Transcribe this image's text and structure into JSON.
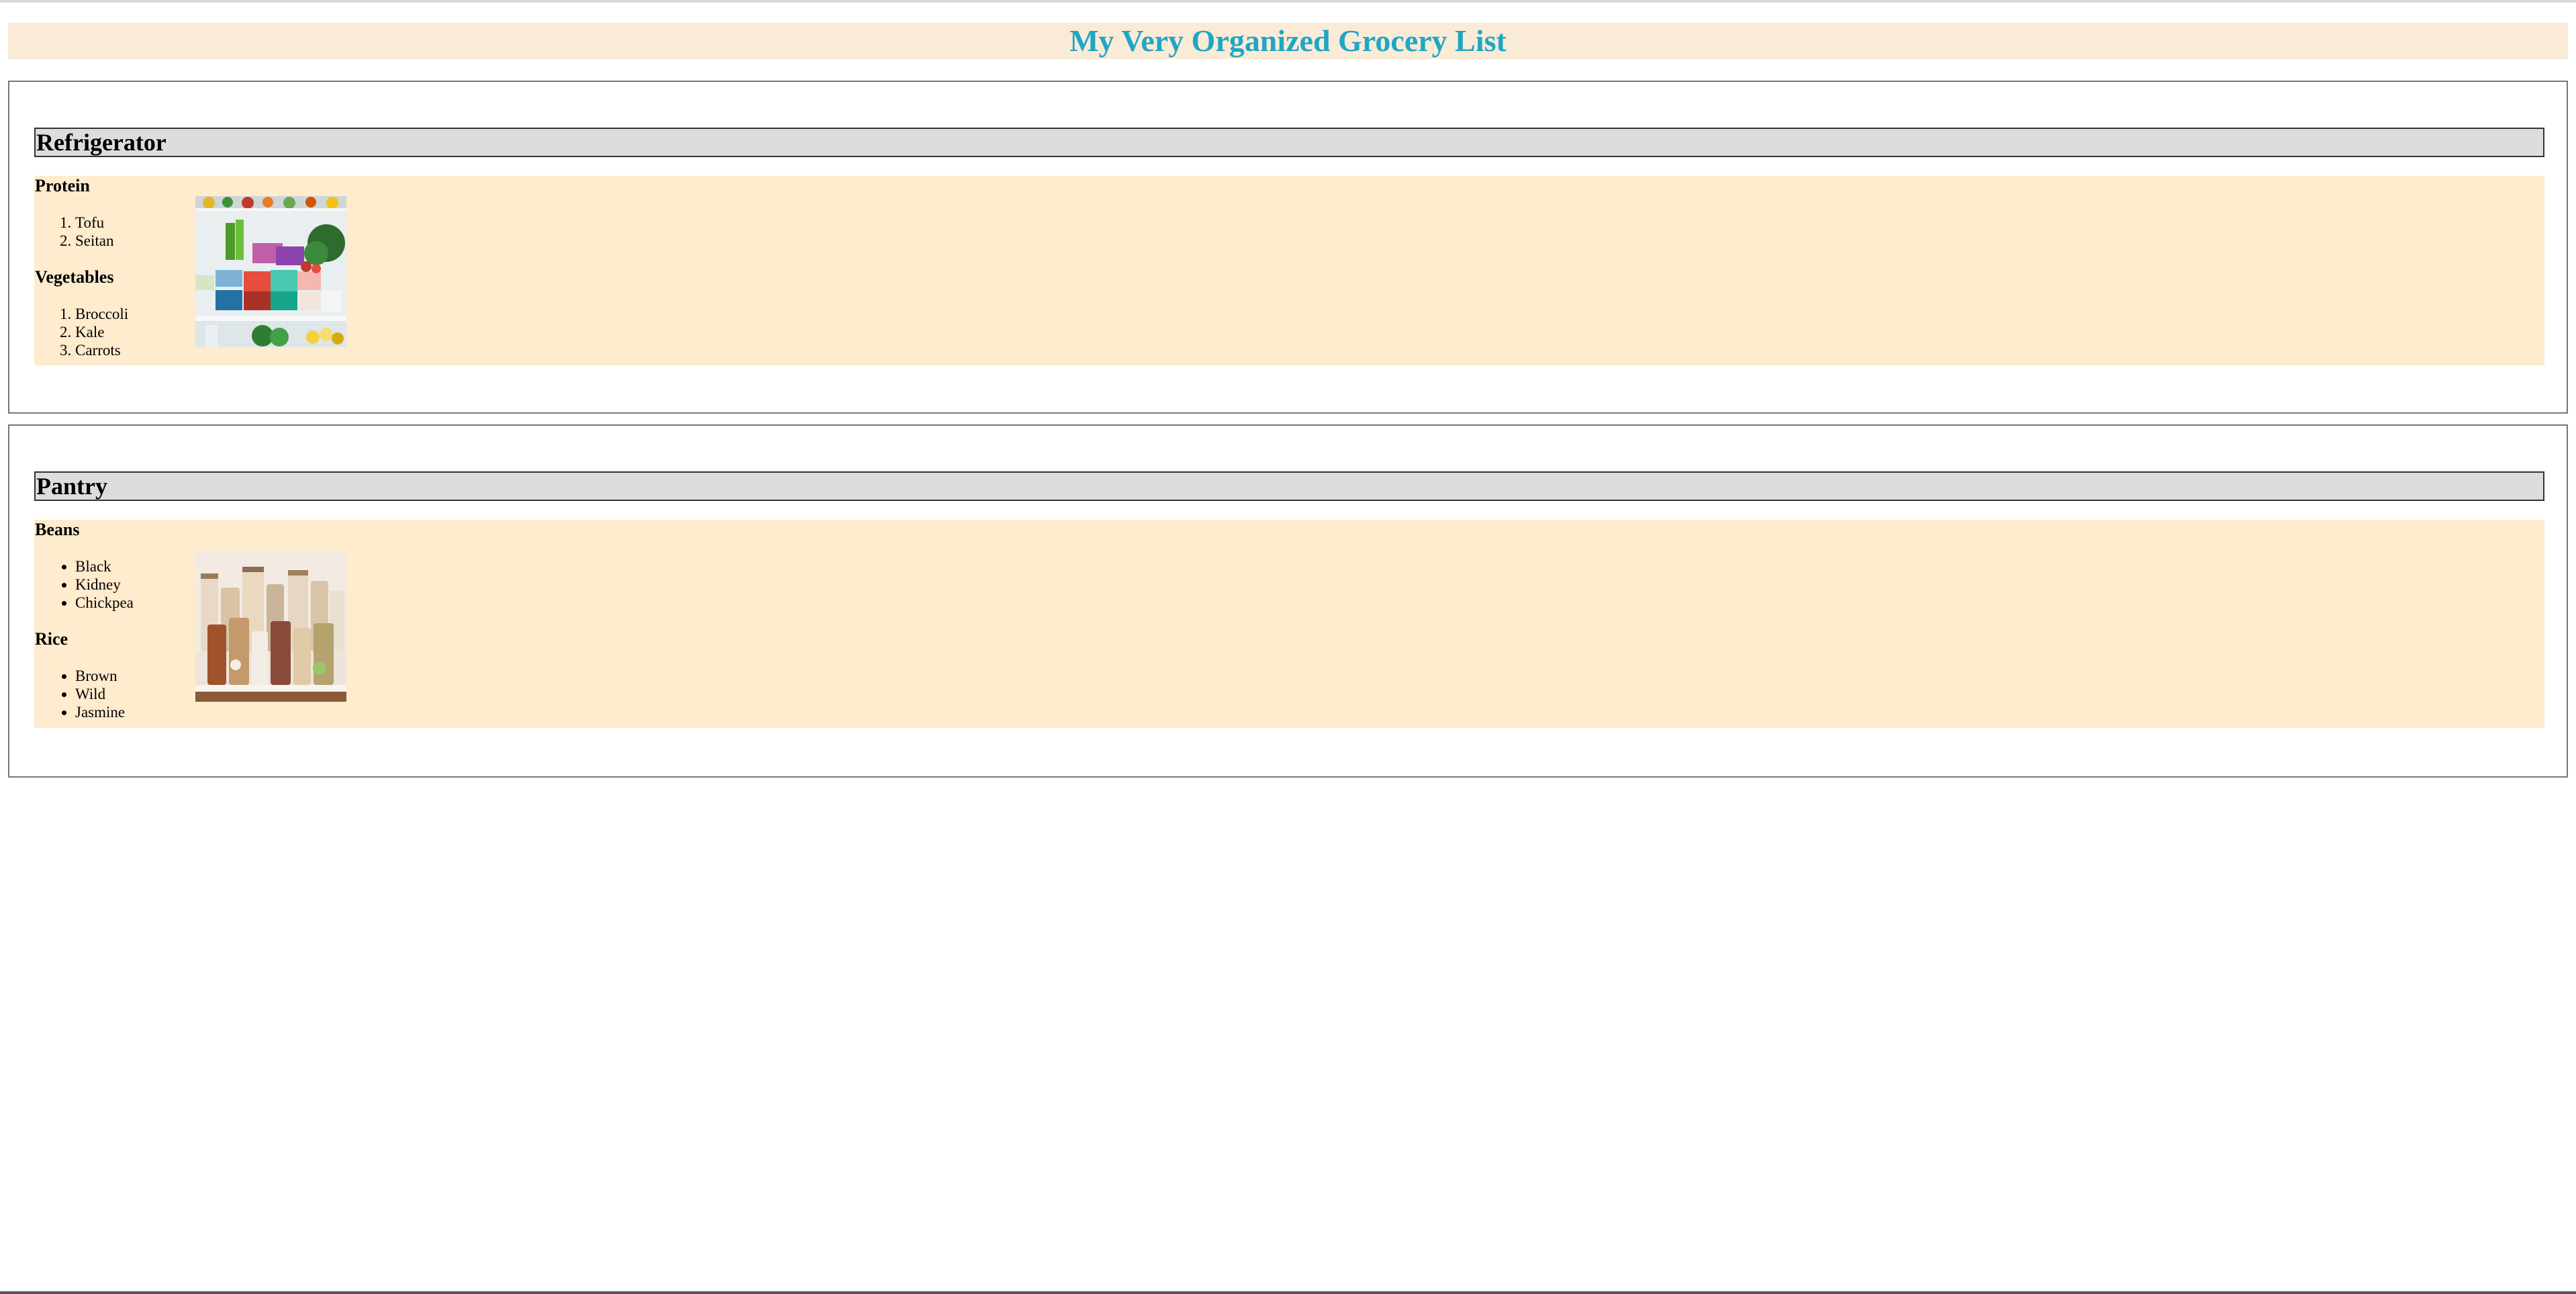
{
  "page": {
    "title": "My Very Organized Grocery List"
  },
  "sections": [
    {
      "heading": "Refrigerator",
      "groups": [
        {
          "title": "Protein",
          "list_style": "ordered",
          "items": [
            "Tofu",
            "Seitan"
          ]
        },
        {
          "title": "Vegetables",
          "list_style": "ordered",
          "items": [
            "Broccoli",
            "Kale",
            "Carrots"
          ]
        }
      ],
      "image_subject": "refrigerator-shelves-photo"
    },
    {
      "heading": "Pantry",
      "groups": [
        {
          "title": "Beans",
          "list_style": "unordered",
          "items": [
            "Black",
            "Kidney",
            "Chickpea"
          ]
        },
        {
          "title": "Rice",
          "list_style": "unordered",
          "items": [
            "Brown",
            "Wild",
            "Jasmine"
          ]
        }
      ],
      "image_subject": "pantry-jars-photo"
    }
  ],
  "colors": {
    "title_text": "#1ea7c5",
    "title_bar": "#faebd7",
    "panel": "#ffebcd",
    "heading_bar": "#dddddd"
  }
}
